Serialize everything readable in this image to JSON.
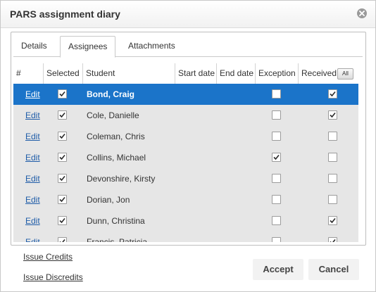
{
  "dialog": {
    "title": "PARS assignment diary",
    "close_icon": "close-circle-icon"
  },
  "tabs": [
    {
      "label": "Details",
      "active": false
    },
    {
      "label": "Assignees",
      "active": true
    },
    {
      "label": "Attachments",
      "active": false
    }
  ],
  "grid": {
    "columns": {
      "num": "#",
      "selected": "Selected",
      "student": "Student",
      "start_date": "Start date",
      "end_date": "End date",
      "exception": "Exception",
      "received": "Received",
      "received_all_button": "All"
    },
    "rows": [
      {
        "edit": "Edit",
        "student": "Bond, Craig",
        "selected": true,
        "exception": false,
        "received": true,
        "highlight": true
      },
      {
        "edit": "Edit",
        "student": "Cole, Danielle",
        "selected": true,
        "exception": false,
        "received": true,
        "highlight": false
      },
      {
        "edit": "Edit",
        "student": "Coleman, Chris",
        "selected": true,
        "exception": false,
        "received": false,
        "highlight": false
      },
      {
        "edit": "Edit",
        "student": "Collins, Michael",
        "selected": true,
        "exception": true,
        "received": false,
        "highlight": false
      },
      {
        "edit": "Edit",
        "student": "Devonshire, Kirsty",
        "selected": true,
        "exception": false,
        "received": false,
        "highlight": false
      },
      {
        "edit": "Edit",
        "student": "Dorian, Jon",
        "selected": true,
        "exception": false,
        "received": false,
        "highlight": false
      },
      {
        "edit": "Edit",
        "student": "Dunn, Christina",
        "selected": true,
        "exception": false,
        "received": true,
        "highlight": false
      },
      {
        "edit": "Edit",
        "student": "Francis, Patricia",
        "selected": true,
        "exception": false,
        "received": true,
        "highlight": false
      }
    ]
  },
  "footer": {
    "issue_credits": "Issue Credits",
    "issue_discredits": "Issue Discredits",
    "accept": "Accept",
    "cancel": "Cancel"
  },
  "colors": {
    "selected_row": "#1b74c9",
    "row_bg": "#e6e6e6",
    "link": "#1f5ca8"
  }
}
